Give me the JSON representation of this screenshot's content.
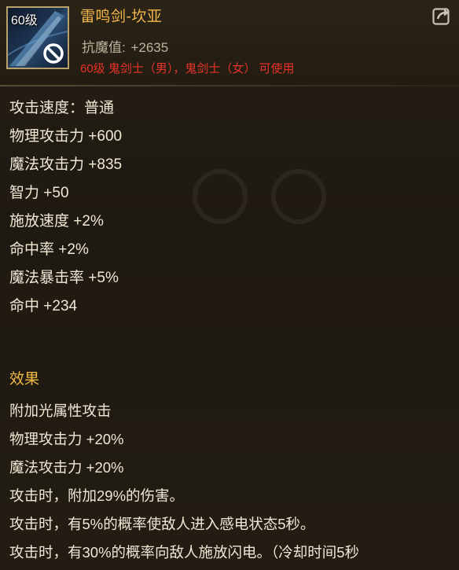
{
  "item": {
    "level_badge": "60级",
    "name": "雷鸣剑-坎亚",
    "magic_resist_label": "抗魔值:",
    "magic_resist_value": "+2635",
    "class_requirement": "60级 鬼剑士（男），鬼剑士（女） 可使用"
  },
  "icons": {
    "weapon": "sword-icon",
    "restricted": "prohibited-icon",
    "share": "share-icon"
  },
  "stats": [
    "攻击速度：普通",
    "物理攻击力 +600",
    "魔法攻击力 +835",
    "智力 +50",
    "施放速度 +2%",
    "命中率 +2%",
    "魔法暴击率 +5%",
    "命中 +234"
  ],
  "effects": {
    "title": "效果",
    "lines": [
      "附加光属性攻击",
      "物理攻击力 +20%",
      "魔法攻击力 +20%",
      "攻击时，附加29%的伤害。",
      "攻击时，有5%的概率使敌人进入感电状态5秒。",
      "攻击时，有30%的概率向敌人施放闪电。（冷却时间5秒"
    ]
  },
  "colors": {
    "item_name": "#f4b74a",
    "class_requirement": "#e8322a",
    "effect_title": "#f1b945",
    "body_text": "#f0e8d4",
    "background": "#1f1a11"
  }
}
